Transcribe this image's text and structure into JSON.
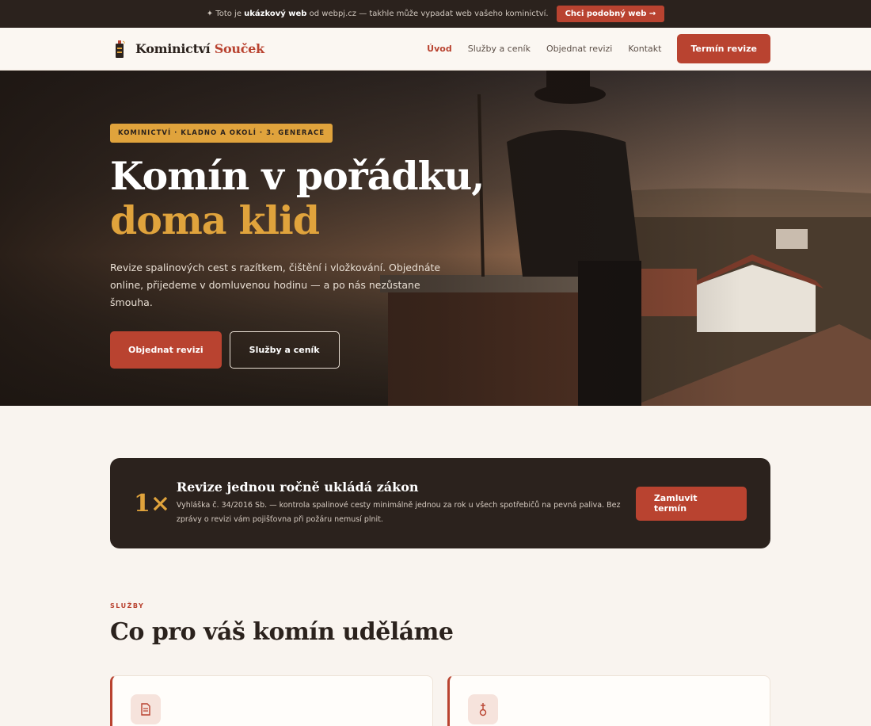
{
  "promo": {
    "prefix": "✦ Toto je",
    "strong": "ukázkový web",
    "suffix": "od webpj.cz — takhle může vypadat web vašeho kominictví.",
    "button": "Chci podobný web →"
  },
  "header": {
    "logo_main": "Kominictví",
    "logo_accent": "Souček",
    "nav": [
      "Úvod",
      "Služby a ceník",
      "Objednat revizi",
      "Kontakt"
    ],
    "active_index": 0,
    "cta": "Termín revize"
  },
  "hero": {
    "badge": "KOMINICTVÍ · KLADNO A OKOLÍ · 3. GENERACE",
    "title_line1": "Komín v pořádku,",
    "title_line2": "doma klid",
    "subtitle": "Revize spalinových cest s razítkem, čištění i vložkování. Objednáte online, přijedeme v domluvenou hodinu — a po nás nezůstane šmouha.",
    "primary_button": "Objednat revizi",
    "secondary_button": "Služby a ceník"
  },
  "notice": {
    "number": "1×",
    "title": "Revize jednou ročně ukládá zákon",
    "description": "Vyhláška č. 34/2016 Sb. — kontrola spalinové cesty minimálně jednou za rok u všech spotřebičů na pevná paliva. Bez zprávy o revizi vám pojišťovna při požáru nemusí plnit.",
    "button": "Zamluvit termín"
  },
  "services": {
    "kicker": "SLUŽBY",
    "title": "Co pro váš komín uděláme",
    "cards": [
      {
        "icon": "document-icon"
      },
      {
        "icon": "brush-icon"
      }
    ]
  },
  "colors": {
    "accent": "#b94330",
    "gold": "#e0a33c",
    "dark": "#2b221d",
    "background": "#f9f4ef"
  }
}
